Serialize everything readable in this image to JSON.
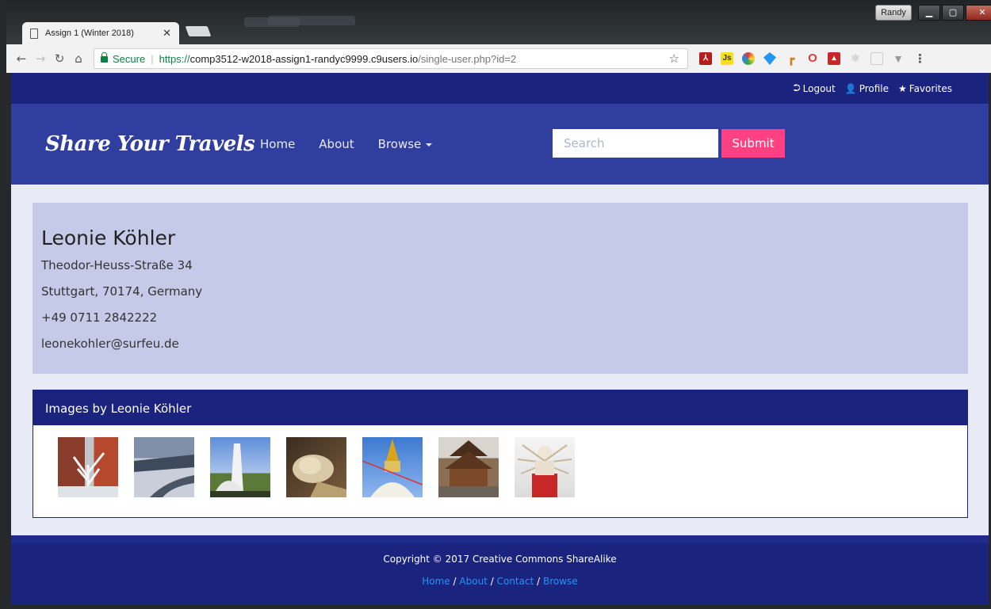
{
  "browser": {
    "tab_title": "Assign 1 (Winter 2018)",
    "profile_name": "Randy",
    "secure_label": "Secure",
    "url_scheme": "https://",
    "url_host": "comp3512-w2018-assign1-randyc9999.c9users.io",
    "url_path": "/single-user.php?id=2"
  },
  "topbar": {
    "logout": "Logout",
    "profile": "Profile",
    "favorites": "Favorites"
  },
  "nav": {
    "brand": "Share Your Travels",
    "home": "Home",
    "about": "About",
    "browse": "Browse",
    "search_placeholder": "Search",
    "submit": "Submit"
  },
  "user": {
    "name": "Leonie Köhler",
    "address": "Theodor-Heuss-Straße 34",
    "city_line": "Stuttgart, 70174, Germany",
    "phone": "+49 0711 2842222",
    "email": "leonekohler@surfeu.de"
  },
  "images": {
    "heading": "Images by Leonie Köhler",
    "thumbnails": [
      "thumbnail-snowy-tree-building",
      "thumbnail-snowy-road",
      "thumbnail-white-monument",
      "thumbnail-reclining-buddha",
      "thumbnail-stupa",
      "thumbnail-nepal-temple",
      "thumbnail-many-armed-statue"
    ]
  },
  "footer": {
    "copyright": "Copyright © 2017 Creative Commons ShareAlike",
    "links": [
      "Home",
      "About",
      "Contact",
      "Browse"
    ],
    "separator": "/"
  }
}
